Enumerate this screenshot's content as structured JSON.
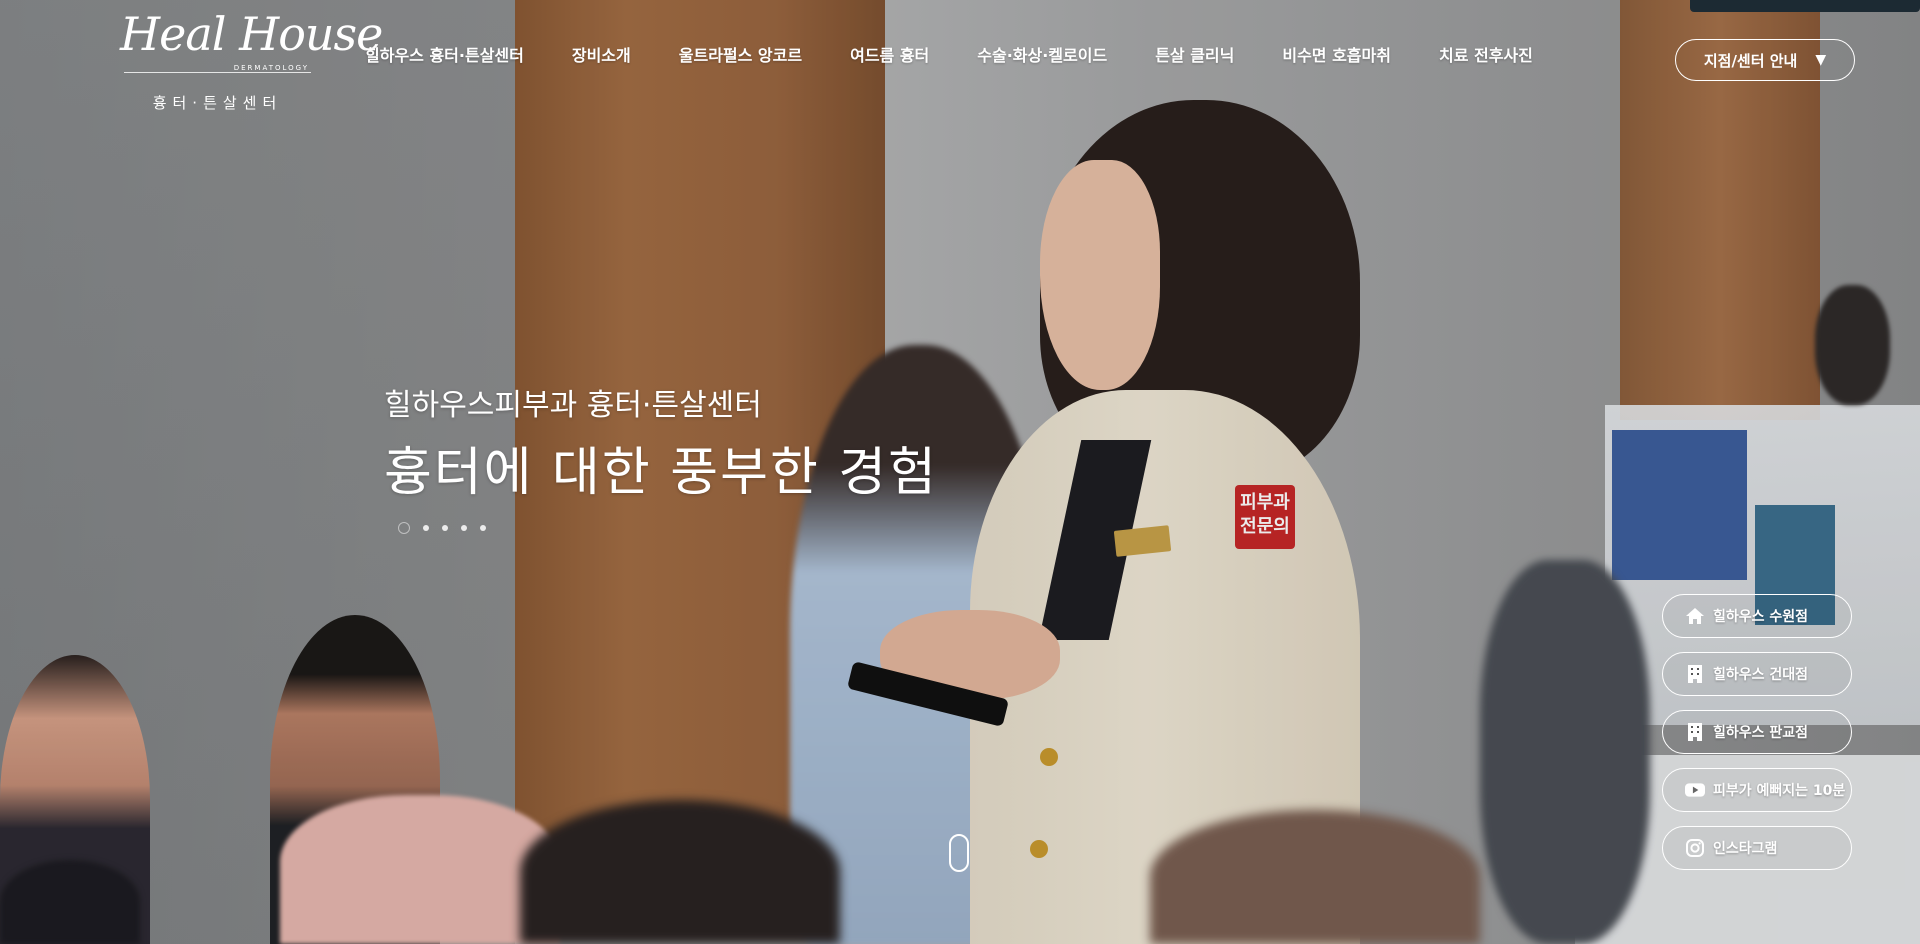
{
  "logo": {
    "script": "Heal House",
    "sub": "DERMATOLOGY",
    "korean": "흉터·튼살센터"
  },
  "nav": [
    {
      "label": "힐하우스 흉터·튼살센터"
    },
    {
      "label": "장비소개"
    },
    {
      "label": "울트라펄스 앙코르"
    },
    {
      "label": "여드름 흉터"
    },
    {
      "label": "수술·화상·켈로이드"
    },
    {
      "label": "튼살 클리닉"
    },
    {
      "label": "비수면 호흡마취"
    },
    {
      "label": "치료 전후사진"
    }
  ],
  "branch_button": {
    "label": "지점/센터 안내",
    "icon": "caret-down-icon"
  },
  "hero": {
    "subtitle": "힐하우스피부과 흉터·튼살센터",
    "title": "흉터에 대한 풍부한 경험",
    "slide_count": 5,
    "active_slide": 1,
    "patch_text_1": "피부과",
    "patch_text_2": "전문의"
  },
  "quick_links": [
    {
      "label": "힐하우스 수원점",
      "icon": "home-icon"
    },
    {
      "label": "힐하우스 건대점",
      "icon": "building-icon"
    },
    {
      "label": "힐하우스 판교점",
      "icon": "building-icon"
    },
    {
      "label": "피부가 예뻐지는 10분",
      "icon": "youtube-icon"
    },
    {
      "label": "인스타그램",
      "icon": "instagram-icon"
    }
  ]
}
